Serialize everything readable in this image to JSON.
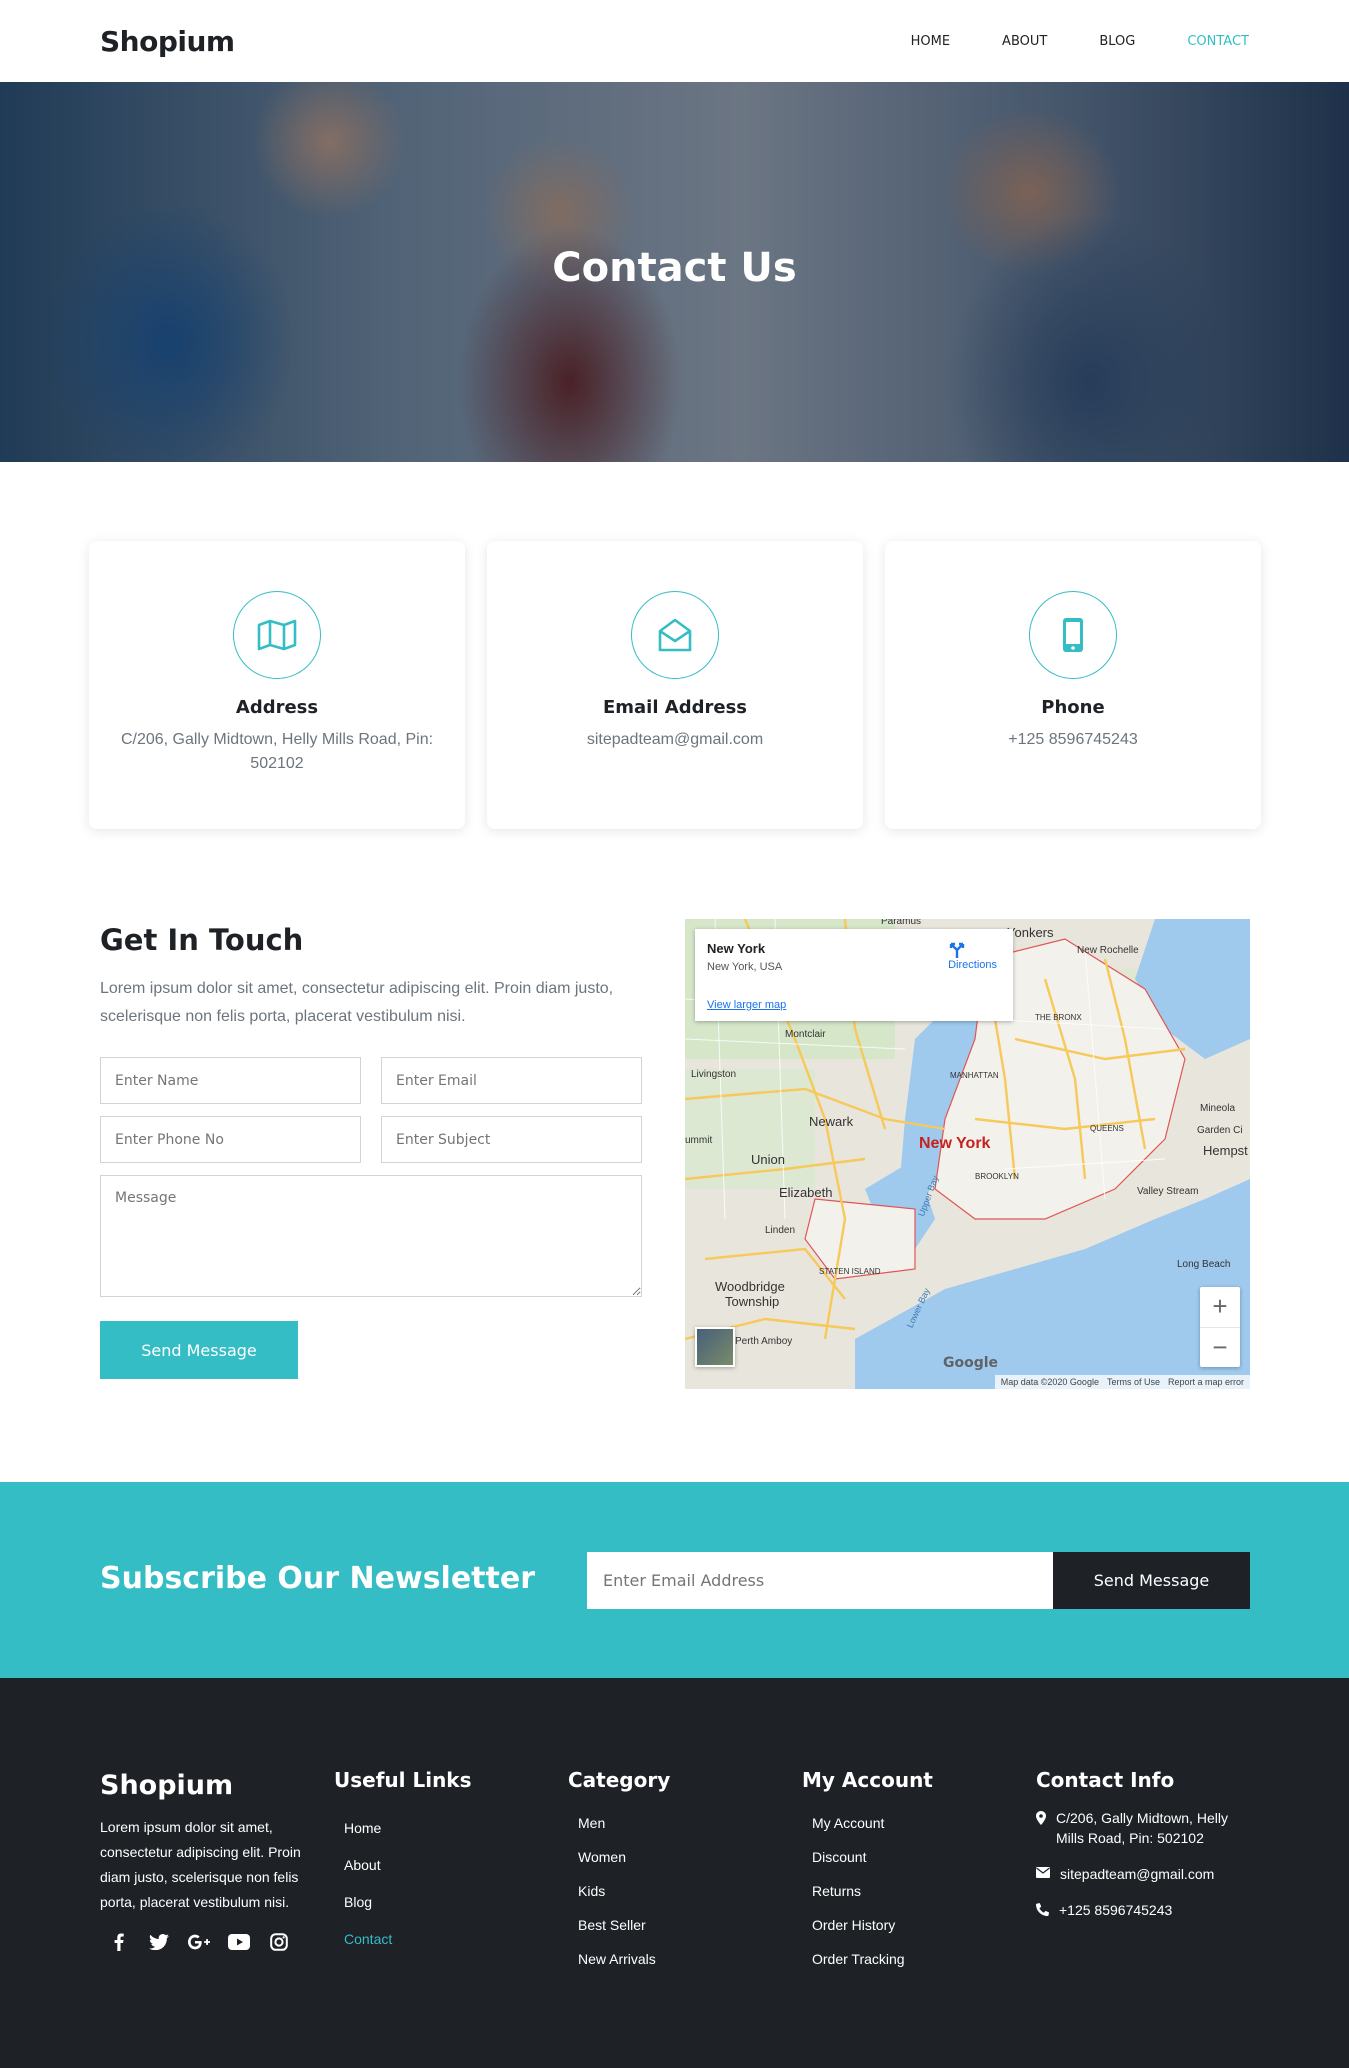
{
  "brand": "Shopium",
  "nav": [
    "HOME",
    "ABOUT",
    "BLOG",
    "CONTACT"
  ],
  "accent_color": "#35bdc5",
  "hero": {
    "title": "Contact Us"
  },
  "cards": [
    {
      "icon": "map-icon",
      "title": "Address",
      "text": "C/206, Gally Midtown, Helly Mills Road, Pin: 502102"
    },
    {
      "icon": "envelope-open-icon",
      "title": "Email Address",
      "text": "sitepadteam@gmail.com"
    },
    {
      "icon": "mobile-phone-icon",
      "title": "Phone",
      "text": "+125 8596745243"
    }
  ],
  "touch": {
    "title": "Get In Touch",
    "text": "Lorem ipsum dolor sit amet, consectetur adipiscing elit. Proin diam justo, scelerisque non felis porta, placerat vestibulum nisi.",
    "name_placeholder": "Enter Name",
    "email_placeholder": "Enter Email",
    "phone_placeholder": "Enter Phone No",
    "subject_placeholder": "Enter Subject",
    "message_placeholder": "Message",
    "button": "Send Message"
  },
  "map": {
    "place": "New York",
    "place_sub": "New York, USA",
    "larger": "View larger map",
    "directions": "Directions",
    "footer": [
      "Map data ©2020 Google",
      "Terms of Use",
      "Report a map error"
    ],
    "google": "Google",
    "labels": [
      "Paramus",
      "Yonkers",
      "New Rochelle",
      "THE BRONX",
      "Montclair",
      "Livingston",
      "MANHATTAN",
      "Newark",
      "QUEENS",
      "Mineola",
      "Garden Ci",
      "Hempst",
      "ummit",
      "Union",
      "New York",
      "BROOKLYN",
      "Valley Stream",
      "Elizabeth",
      "Linden",
      "STATEN ISLAND",
      "Long Beach",
      "Woodbridge",
      "Township",
      "Perth Amboy",
      "Upper Bay",
      "Lower Bay"
    ]
  },
  "newsletter": {
    "title": "Subscribe Our Newsletter",
    "placeholder": "Enter Email Address",
    "button": "Send Message"
  },
  "footer": {
    "brand": "Shopium",
    "about": "Lorem ipsum dolor sit amet, consectetur adipiscing elit. Proin diam justo, scelerisque non felis porta, placerat vestibulum nisi.",
    "useful_title": "Useful Links",
    "useful_links": [
      "Home",
      "About",
      "Blog",
      "Contact"
    ],
    "category_title": "Category",
    "categories": [
      "Men",
      "Women",
      "Kids",
      "Best Seller",
      "New Arrivals"
    ],
    "account_title": "My Account",
    "account_links": [
      "My Account",
      "Discount",
      "Returns",
      "Order History",
      "Order Tracking"
    ],
    "contact_title": "Contact Info",
    "contact_address": "C/206, Gally Midtown, Helly Mills Road, Pin: 502102",
    "contact_email": "sitepadteam@gmail.com",
    "contact_phone": "+125 8596745243"
  }
}
